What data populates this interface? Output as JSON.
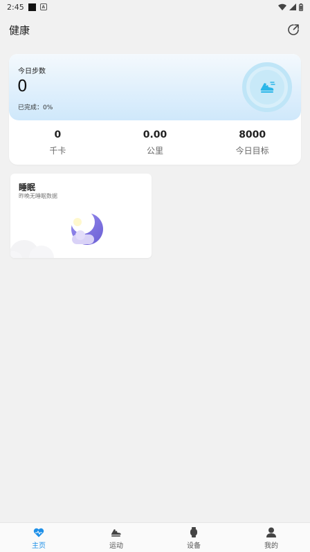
{
  "status_bar": {
    "time": "2:45"
  },
  "header": {
    "title": "健康",
    "share_icon": "share-icon"
  },
  "steps_card": {
    "label": "今日步数",
    "value": "0",
    "progress": "已完成：0%",
    "progress_fraction": 0,
    "icon": "running-shoe-icon",
    "stats": [
      {
        "value": "0",
        "label": "千卡"
      },
      {
        "value": "0.00",
        "label": "公里"
      },
      {
        "value": "8000",
        "label": "今日目标"
      }
    ]
  },
  "sleep_card": {
    "title": "睡眠",
    "subtitle": "昨晚无睡眠数据",
    "icon": "moon-icon"
  },
  "nav": {
    "active": 0,
    "items": [
      {
        "label": "主页",
        "icon": "heart-icon"
      },
      {
        "label": "运动",
        "icon": "sneaker-icon"
      },
      {
        "label": "设备",
        "icon": "watch-icon"
      },
      {
        "label": "我的",
        "icon": "person-icon"
      }
    ]
  },
  "colors": {
    "accent": "#1e90e8",
    "ring": "#bfe5f7",
    "shoe": "#2bb6e8",
    "moon": "#7b6fd8"
  }
}
